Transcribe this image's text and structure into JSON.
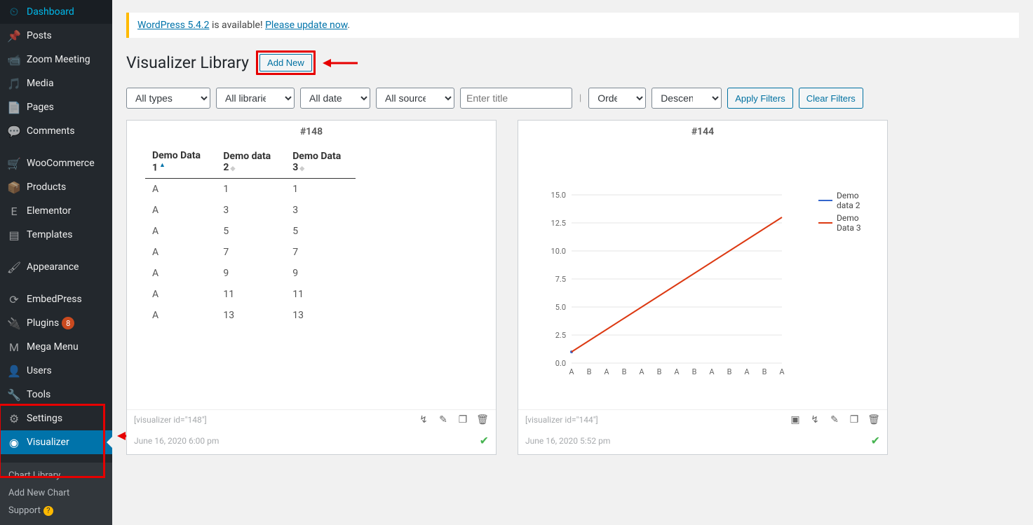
{
  "sidebar": {
    "items": [
      {
        "icon": "speedometer",
        "label": "Dashboard"
      },
      {
        "icon": "pin",
        "label": "Posts"
      },
      {
        "icon": "camera",
        "label": "Zoom Meeting"
      },
      {
        "icon": "media",
        "label": "Media"
      },
      {
        "icon": "page",
        "label": "Pages"
      },
      {
        "icon": "comment",
        "label": "Comments"
      },
      {
        "icon": "woo",
        "label": "WooCommerce"
      },
      {
        "icon": "box",
        "label": "Products"
      },
      {
        "icon": "elementor",
        "label": "Elementor"
      },
      {
        "icon": "templates",
        "label": "Templates"
      },
      {
        "icon": "brush",
        "label": "Appearance"
      },
      {
        "icon": "embed",
        "label": "EmbedPress"
      },
      {
        "icon": "plug",
        "label": "Plugins",
        "badge": "8"
      },
      {
        "icon": "mega",
        "label": "Mega Menu"
      },
      {
        "icon": "user",
        "label": "Users"
      },
      {
        "icon": "wrench",
        "label": "Tools"
      },
      {
        "icon": "gear",
        "label": "Settings"
      },
      {
        "icon": "vis",
        "label": "Visualizer",
        "active": true
      }
    ],
    "submenu": [
      "Chart Library",
      "Add New Chart",
      "Support"
    ]
  },
  "notice": {
    "pre": "WordPress 5.4.2",
    "mid": " is available! ",
    "link": "Please update now",
    "post": "."
  },
  "page": {
    "title": "Visualizer Library",
    "add_new": "Add New"
  },
  "filters": {
    "types": "All types",
    "libraries": "All libraries",
    "dates": "All dates",
    "sources": "All sources",
    "title_placeholder": "Enter title",
    "order_by": "Order By",
    "direction": "Descending",
    "apply": "Apply Filters",
    "clear": "Clear Filters"
  },
  "cards": [
    {
      "id": "#148",
      "shortcode": "[visualizer id=\"148\"]",
      "date": "June 16, 2020 6:00 pm"
    },
    {
      "id": "#144",
      "shortcode": "[visualizer id=\"144\"]",
      "date": "June 16, 2020 5:52 pm"
    }
  ],
  "chart_data": [
    {
      "type": "table",
      "columns": [
        "Demo Data 1",
        "Demo data 2",
        "Demo Data 3"
      ],
      "rows": [
        [
          "A",
          "1",
          "1"
        ],
        [
          "A",
          "3",
          "3"
        ],
        [
          "A",
          "5",
          "5"
        ],
        [
          "A",
          "7",
          "7"
        ],
        [
          "A",
          "9",
          "9"
        ],
        [
          "A",
          "11",
          "11"
        ],
        [
          "A",
          "13",
          "13"
        ]
      ]
    },
    {
      "type": "line",
      "x_categories": [
        "A",
        "B",
        "A",
        "B",
        "A",
        "B",
        "A",
        "B",
        "A",
        "B",
        "A",
        "B",
        "A"
      ],
      "series": [
        {
          "name": "Demo data 2",
          "color": "#3366cc",
          "values": [
            1
          ]
        },
        {
          "name": "Demo Data 3",
          "color": "#dc3912",
          "values": [
            1,
            2,
            3,
            4,
            5,
            6,
            7,
            8,
            9,
            10,
            11,
            12,
            13
          ]
        }
      ],
      "ylim": [
        0,
        15
      ],
      "yticks": [
        0.0,
        2.5,
        5.0,
        7.5,
        10.0,
        12.5,
        15.0
      ]
    }
  ]
}
